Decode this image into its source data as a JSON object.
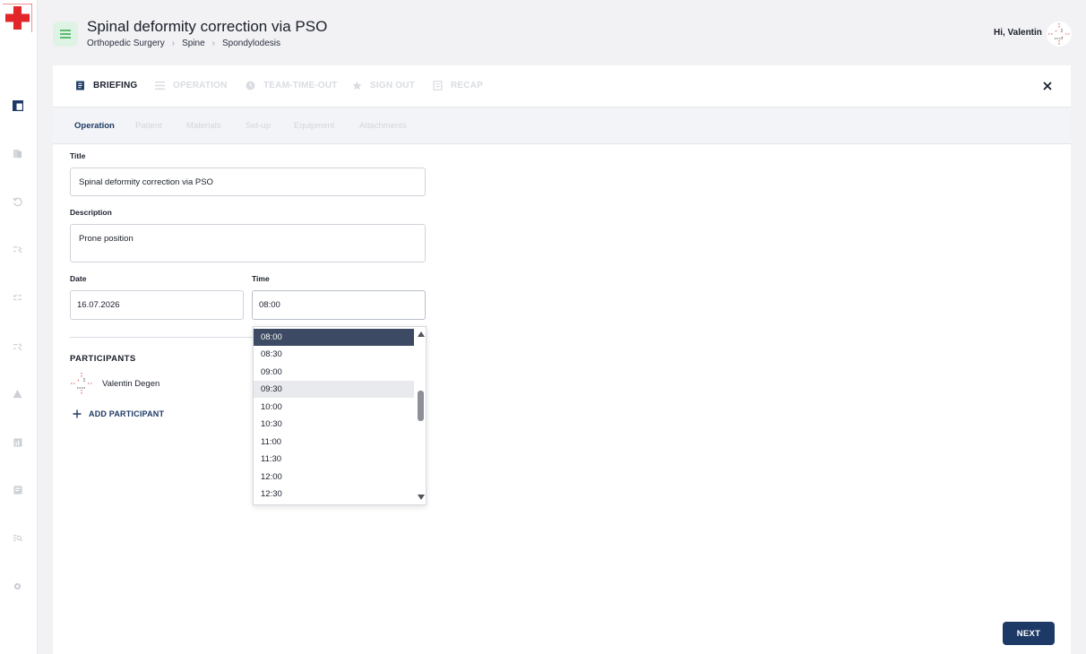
{
  "app": {
    "page_title": "Spinal deformity correction via PSO",
    "breadcrumb": [
      "Orthopedic Surgery",
      "Spine",
      "Spondylodesis"
    ],
    "greeting": "Hi, Valentin",
    "brand_color": "#e3262a",
    "accent_color": "#1d3a66"
  },
  "sidebar": {
    "icons": [
      "dashboard-icon",
      "library-icon",
      "history-icon",
      "workflow-icon",
      "checklist-icon",
      "steps-icon",
      "warning-icon",
      "reports-icon",
      "board-icon",
      "search-list-icon",
      "settings-icon"
    ]
  },
  "phases": [
    {
      "label": "BRIEFING",
      "icon": "briefing-icon",
      "active": true
    },
    {
      "label": "OPERATION",
      "icon": "operation-icon",
      "active": false
    },
    {
      "label": "TEAM-TIME-OUT",
      "icon": "timeout-icon",
      "active": false
    },
    {
      "label": "SIGN OUT",
      "icon": "star-icon",
      "active": false
    },
    {
      "label": "RECAP",
      "icon": "recap-icon",
      "active": false
    }
  ],
  "sub_tabs": [
    "Operation",
    "Patient",
    "Materials",
    "Set-up",
    "Equipment",
    "Attachments"
  ],
  "form": {
    "title_label": "Title",
    "title_value": "Spinal deformity correction via PSO",
    "description_label": "Description",
    "description_value": "Prone position",
    "date_label": "Date",
    "date_value": "16.07.2026",
    "time_label": "Time",
    "time_value": "08:00"
  },
  "participants": {
    "title": "PARTICIPANTS",
    "items": [
      {
        "name": "Valentin Degen"
      }
    ],
    "add_label": "ADD PARTICIPANT"
  },
  "time_dropdown": {
    "options": [
      "08:00",
      "08:30",
      "09:00",
      "09:30",
      "10:00",
      "10:30",
      "11:00",
      "11:30",
      "12:00",
      "12:30"
    ],
    "selected": "08:00",
    "hovered": "09:30"
  },
  "actions": {
    "next_label": "NEXT"
  }
}
